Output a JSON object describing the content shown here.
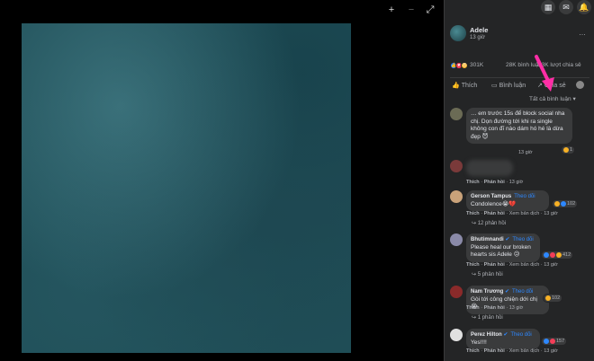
{
  "viewer": {
    "zoom_in": "+",
    "zoom_out": "−",
    "fullscreen": "⤢"
  },
  "topbar": {
    "menu_icon": "▦",
    "messenger_icon": "✉",
    "notifications_icon": "🔔"
  },
  "post": {
    "author": "Adele",
    "time": "13 giờ",
    "more": "…",
    "reactions_count": "301K",
    "comments_count": "28K bình luận",
    "shares_count": "23K lượt chia sẻ"
  },
  "actions": {
    "like": "Thích",
    "comment": "Bình luận",
    "share": "Chia sẻ"
  },
  "sort_label": "Tất cả bình luận",
  "comments": [
    {
      "name": "",
      "text": "… em trước 15s để block social nha chị. Dọn đường tới khi ra single không con đĩ nào dám hó hé là dừa đẹp 😈",
      "time": "13 giờ",
      "reaction_count": "1"
    },
    {
      "name": "",
      "text": "",
      "like": "Thích",
      "reply": "Phản hồi",
      "time": "13 giờ"
    },
    {
      "name": "Gerson Tampus",
      "follow": "Theo dõi",
      "text": "Condolence😭💔",
      "like": "Thích",
      "reply": "Phản hồi",
      "translate": "Xem bản dịch",
      "time": "13 giờ",
      "reaction_count": "102",
      "replies": "12 phản hồi"
    },
    {
      "name": "Bhutimnandi",
      "follow": "Theo dõi",
      "text": "Please heal our broken hearts sis Adele 😥",
      "like": "Thích",
      "reply": "Phản hồi",
      "translate": "Xem bản dịch",
      "time": "13 giờ",
      "reaction_count": "412",
      "replies": "5 phản hồi"
    },
    {
      "name": "Nam Trương",
      "follow": "Theo dõi",
      "text": "Gòi tới công chiện dới chị 😭",
      "like": "Thích",
      "reply": "Phản hồi",
      "time": "13 giờ",
      "reaction_count": "102",
      "replies": "1 phản hồi"
    },
    {
      "name": "Perez Hilton",
      "follow": "Theo dõi",
      "text": "Yes!!!!",
      "like": "Thích",
      "reply": "Phản hồi",
      "translate": "Xem bản dịch",
      "time": "13 giờ",
      "reaction_count": "157"
    }
  ],
  "colors": {
    "accent": "#2d88ff",
    "arrow": "#ff2ea6",
    "panel": "#242526",
    "bubble": "#3a3b3c"
  }
}
